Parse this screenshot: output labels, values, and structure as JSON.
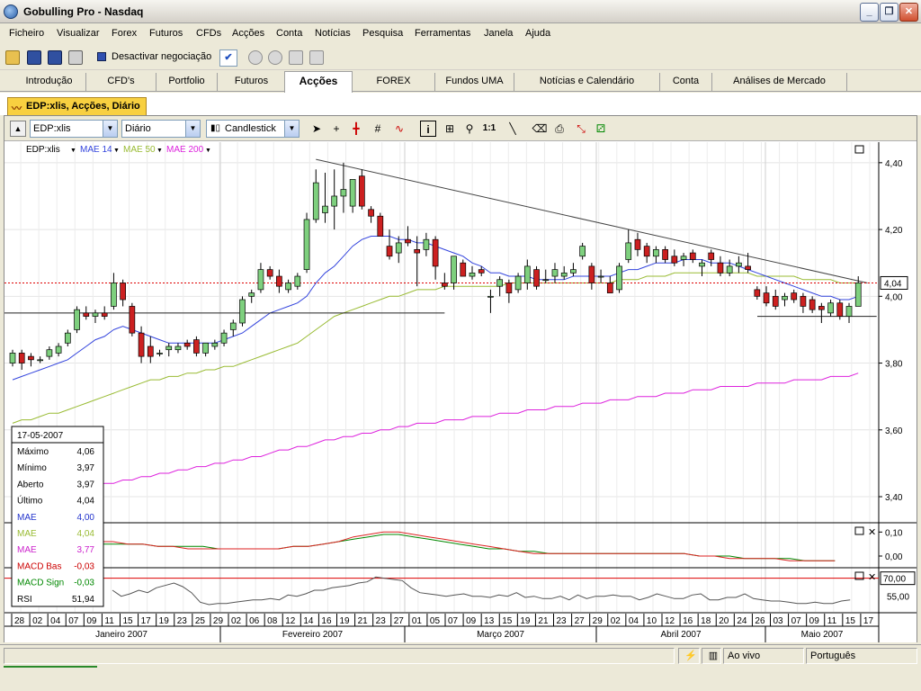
{
  "window": {
    "title": "Gobulling Pro - Nasdaq"
  },
  "menu": [
    "Ficheiro",
    "Visualizar",
    "Forex",
    "Futuros",
    "CFDs",
    "Acções",
    "Conta",
    "Notícias",
    "Pesquisa",
    "Ferramentas",
    "Janela",
    "Ajuda"
  ],
  "toolbar": {
    "deactivate_label": "Desactivar negociação"
  },
  "tabs": [
    {
      "label": "Introdução"
    },
    {
      "label": "CFD's"
    },
    {
      "label": "Portfolio"
    },
    {
      "label": "Futuros"
    },
    {
      "label": "Acções",
      "active": true
    },
    {
      "label": "FOREX"
    },
    {
      "label": "Fundos UMA"
    },
    {
      "label": "Notícias e Calendário"
    },
    {
      "label": "Conta"
    },
    {
      "label": "Análises de Mercado"
    }
  ],
  "document_tab": "EDP:xlis, Acções, Diário",
  "chart_toolbar": {
    "symbol": "EDP:xlis",
    "period": "Diário",
    "style": "Candlestick"
  },
  "legend": [
    {
      "label": "EDP:xlis",
      "color": "#000000"
    },
    {
      "label": "MAE 14",
      "color": "#3344dd"
    },
    {
      "label": "MAE 50",
      "color": "#99bb33"
    },
    {
      "label": "MAE 200",
      "color": "#dd22dd"
    }
  ],
  "info_box": {
    "date": "17-05-2007",
    "rows": [
      {
        "label": "Máximo",
        "value": "4,06",
        "color": "#000000"
      },
      {
        "label": "Mínimo",
        "value": "3,97",
        "color": "#000000"
      },
      {
        "label": "Aberto",
        "value": "3,97",
        "color": "#000000"
      },
      {
        "label": "Último",
        "value": "4,04",
        "color": "#000000"
      },
      {
        "label": "MAE",
        "value": "4,00",
        "color": "#2233cc"
      },
      {
        "label": "MAE",
        "value": "4,04",
        "color": "#99bb33"
      },
      {
        "label": "MAE",
        "value": "3,77",
        "color": "#cc22cc"
      },
      {
        "label": "MACD Bas",
        "value": "-0,03",
        "color": "#cc0000"
      },
      {
        "label": "MACD Sign",
        "value": "-0,03",
        "color": "#008800"
      },
      {
        "label": "RSI",
        "value": "51,94",
        "color": "#000000"
      }
    ]
  },
  "price_axis_labels": [
    "4,40",
    "4,20",
    "4,00",
    "3,80",
    "3,60",
    "3,40"
  ],
  "macd_axis_labels": [
    "0,10",
    "0,00"
  ],
  "rsi_axis_labels": [
    "70,00",
    "55,00"
  ],
  "last_price_label": "4,04",
  "date_labels": [
    "28",
    "02",
    "04",
    "07",
    "09",
    "11",
    "15",
    "17",
    "19",
    "23",
    "25",
    "29",
    "02",
    "06",
    "08",
    "12",
    "14",
    "16",
    "19",
    "21",
    "23",
    "27",
    "01",
    "05",
    "07",
    "09",
    "13",
    "15",
    "19",
    "21",
    "23",
    "27",
    "29",
    "02",
    "04",
    "10",
    "12",
    "16",
    "18",
    "20",
    "24",
    "26",
    "03",
    "07",
    "09",
    "11",
    "15",
    "17"
  ],
  "month_labels": [
    "Janeiro 2007",
    "Fevereiro 2007",
    "Março 2007",
    "Abril 2007",
    "Maio 2007"
  ],
  "statusbar": {
    "mode": "Ao vivo",
    "language": "Português"
  },
  "colors": {
    "up": "#7ed07e",
    "down": "#cc2020",
    "accent": "#f8d040",
    "last_line": "#dd0000"
  },
  "chart_data": {
    "type": "candlestick",
    "ylim": [
      3.33,
      4.44
    ],
    "candles": [
      {
        "o": 3.8,
        "h": 3.84,
        "l": 3.79,
        "c": 3.83
      },
      {
        "o": 3.83,
        "h": 3.84,
        "l": 3.78,
        "c": 3.8
      },
      {
        "o": 3.82,
        "h": 3.83,
        "l": 3.79,
        "c": 3.81
      },
      {
        "o": 3.81,
        "h": 3.82,
        "l": 3.8,
        "c": 3.81
      },
      {
        "o": 3.82,
        "h": 3.85,
        "l": 3.81,
        "c": 3.84
      },
      {
        "o": 3.83,
        "h": 3.86,
        "l": 3.82,
        "c": 3.85
      },
      {
        "o": 3.86,
        "h": 3.9,
        "l": 3.85,
        "c": 3.89
      },
      {
        "o": 3.9,
        "h": 3.97,
        "l": 3.89,
        "c": 3.96
      },
      {
        "o": 3.95,
        "h": 3.97,
        "l": 3.93,
        "c": 3.94
      },
      {
        "o": 3.94,
        "h": 3.96,
        "l": 3.92,
        "c": 3.95
      },
      {
        "o": 3.95,
        "h": 3.97,
        "l": 3.93,
        "c": 3.94
      },
      {
        "o": 3.97,
        "h": 4.07,
        "l": 3.96,
        "c": 4.04
      },
      {
        "o": 4.04,
        "h": 4.05,
        "l": 3.97,
        "c": 3.99
      },
      {
        "o": 3.97,
        "h": 3.98,
        "l": 3.88,
        "c": 3.89
      },
      {
        "o": 3.89,
        "h": 3.91,
        "l": 3.8,
        "c": 3.82
      },
      {
        "o": 3.85,
        "h": 3.88,
        "l": 3.8,
        "c": 3.82
      },
      {
        "o": 3.83,
        "h": 3.84,
        "l": 3.82,
        "c": 3.83
      },
      {
        "o": 3.84,
        "h": 3.86,
        "l": 3.82,
        "c": 3.85
      },
      {
        "o": 3.84,
        "h": 3.86,
        "l": 3.83,
        "c": 3.85
      },
      {
        "o": 3.86,
        "h": 3.87,
        "l": 3.84,
        "c": 3.85
      },
      {
        "o": 3.87,
        "h": 3.88,
        "l": 3.82,
        "c": 3.83
      },
      {
        "o": 3.83,
        "h": 3.86,
        "l": 3.82,
        "c": 3.86
      },
      {
        "o": 3.85,
        "h": 3.87,
        "l": 3.84,
        "c": 3.86
      },
      {
        "o": 3.86,
        "h": 3.9,
        "l": 3.85,
        "c": 3.89
      },
      {
        "o": 3.9,
        "h": 3.93,
        "l": 3.88,
        "c": 3.92
      },
      {
        "o": 3.92,
        "h": 4.0,
        "l": 3.91,
        "c": 3.99
      },
      {
        "o": 4.0,
        "h": 4.02,
        "l": 3.98,
        "c": 4.01
      },
      {
        "o": 4.02,
        "h": 4.1,
        "l": 4.01,
        "c": 4.08
      },
      {
        "o": 4.08,
        "h": 4.09,
        "l": 4.05,
        "c": 4.06
      },
      {
        "o": 4.06,
        "h": 4.08,
        "l": 4.01,
        "c": 4.03
      },
      {
        "o": 4.02,
        "h": 4.05,
        "l": 4.01,
        "c": 4.04
      },
      {
        "o": 4.03,
        "h": 4.07,
        "l": 4.02,
        "c": 4.06
      },
      {
        "o": 4.08,
        "h": 4.25,
        "l": 4.07,
        "c": 4.23
      },
      {
        "o": 4.23,
        "h": 4.38,
        "l": 4.22,
        "c": 4.34
      },
      {
        "o": 4.25,
        "h": 4.37,
        "l": 4.22,
        "c": 4.27
      },
      {
        "o": 4.27,
        "h": 4.38,
        "l": 4.2,
        "c": 4.3
      },
      {
        "o": 4.3,
        "h": 4.4,
        "l": 4.25,
        "c": 4.32
      },
      {
        "o": 4.27,
        "h": 4.34,
        "l": 4.25,
        "c": 4.35
      },
      {
        "o": 4.36,
        "h": 4.38,
        "l": 4.26,
        "c": 4.27
      },
      {
        "o": 4.26,
        "h": 4.27,
        "l": 4.22,
        "c": 4.24
      },
      {
        "o": 4.24,
        "h": 4.25,
        "l": 4.18,
        "c": 4.18
      },
      {
        "o": 4.15,
        "h": 4.2,
        "l": 4.11,
        "c": 4.12
      },
      {
        "o": 4.13,
        "h": 4.18,
        "l": 4.1,
        "c": 4.16
      },
      {
        "o": 4.17,
        "h": 4.21,
        "l": 4.15,
        "c": 4.16
      },
      {
        "o": 4.14,
        "h": 4.18,
        "l": 4.03,
        "c": 4.13
      },
      {
        "o": 4.14,
        "h": 4.19,
        "l": 4.12,
        "c": 4.17
      },
      {
        "o": 4.17,
        "h": 4.18,
        "l": 4.05,
        "c": 4.09
      },
      {
        "o": 4.04,
        "h": 4.07,
        "l": 4.02,
        "c": 4.03
      },
      {
        "o": 4.04,
        "h": 4.12,
        "l": 4.02,
        "c": 4.12
      },
      {
        "o": 4.1,
        "h": 4.11,
        "l": 4.06,
        "c": 4.06
      },
      {
        "o": 4.06,
        "h": 4.09,
        "l": 4.05,
        "c": 4.07
      },
      {
        "o": 4.08,
        "h": 4.09,
        "l": 4.06,
        "c": 4.07
      },
      {
        "o": 4.0,
        "h": 4.02,
        "l": 3.95,
        "c": 4.0
      },
      {
        "o": 4.03,
        "h": 4.06,
        "l": 4.0,
        "c": 4.05
      },
      {
        "o": 4.04,
        "h": 4.05,
        "l": 3.98,
        "c": 4.01
      },
      {
        "o": 4.02,
        "h": 4.07,
        "l": 4.01,
        "c": 4.06
      },
      {
        "o": 4.04,
        "h": 4.11,
        "l": 4.02,
        "c": 4.09
      },
      {
        "o": 4.08,
        "h": 4.09,
        "l": 4.02,
        "c": 4.03
      },
      {
        "o": 4.05,
        "h": 4.08,
        "l": 4.04,
        "c": 4.05
      },
      {
        "o": 4.06,
        "h": 4.1,
        "l": 4.04,
        "c": 4.08
      },
      {
        "o": 4.06,
        "h": 4.09,
        "l": 4.05,
        "c": 4.07
      },
      {
        "o": 4.07,
        "h": 4.1,
        "l": 4.06,
        "c": 4.08
      },
      {
        "o": 4.12,
        "h": 4.16,
        "l": 4.11,
        "c": 4.15
      },
      {
        "o": 4.09,
        "h": 4.1,
        "l": 4.02,
        "c": 4.04
      },
      {
        "o": 4.06,
        "h": 4.08,
        "l": 4.04,
        "c": 4.06
      },
      {
        "o": 4.04,
        "h": 4.06,
        "l": 4.01,
        "c": 4.01
      },
      {
        "o": 4.02,
        "h": 4.1,
        "l": 4.01,
        "c": 4.09
      },
      {
        "o": 4.11,
        "h": 4.2,
        "l": 4.1,
        "c": 4.16
      },
      {
        "o": 4.17,
        "h": 4.19,
        "l": 4.12,
        "c": 4.14
      },
      {
        "o": 4.15,
        "h": 4.16,
        "l": 4.1,
        "c": 4.12
      },
      {
        "o": 4.12,
        "h": 4.15,
        "l": 4.1,
        "c": 4.14
      },
      {
        "o": 4.14,
        "h": 4.15,
        "l": 4.1,
        "c": 4.11
      },
      {
        "o": 4.12,
        "h": 4.14,
        "l": 4.09,
        "c": 4.1
      },
      {
        "o": 4.11,
        "h": 4.13,
        "l": 4.09,
        "c": 4.12
      },
      {
        "o": 4.13,
        "h": 4.14,
        "l": 4.1,
        "c": 4.11
      },
      {
        "o": 4.09,
        "h": 4.11,
        "l": 4.06,
        "c": 4.1
      },
      {
        "o": 4.13,
        "h": 4.14,
        "l": 4.09,
        "c": 4.11
      },
      {
        "o": 4.1,
        "h": 4.12,
        "l": 4.06,
        "c": 4.07
      },
      {
        "o": 4.07,
        "h": 4.11,
        "l": 4.06,
        "c": 4.09
      },
      {
        "o": 4.09,
        "h": 4.12,
        "l": 4.07,
        "c": 4.1
      },
      {
        "o": 4.09,
        "h": 4.13,
        "l": 4.07,
        "c": 4.08
      },
      {
        "o": 4.02,
        "h": 4.03,
        "l": 3.99,
        "c": 4.0
      },
      {
        "o": 4.01,
        "h": 4.03,
        "l": 3.97,
        "c": 3.98
      },
      {
        "o": 4.0,
        "h": 4.02,
        "l": 3.96,
        "c": 3.97
      },
      {
        "o": 3.99,
        "h": 4.01,
        "l": 3.97,
        "c": 4.0
      },
      {
        "o": 4.01,
        "h": 4.02,
        "l": 3.98,
        "c": 3.99
      },
      {
        "o": 4.0,
        "h": 4.01,
        "l": 3.95,
        "c": 3.97
      },
      {
        "o": 3.99,
        "h": 4.0,
        "l": 3.95,
        "c": 3.96
      },
      {
        "o": 3.97,
        "h": 3.98,
        "l": 3.92,
        "c": 3.96
      },
      {
        "o": 3.95,
        "h": 3.99,
        "l": 3.94,
        "c": 3.98
      },
      {
        "o": 3.98,
        "h": 3.99,
        "l": 3.93,
        "c": 3.94
      },
      {
        "o": 3.94,
        "h": 3.98,
        "l": 3.92,
        "c": 3.97
      },
      {
        "o": 3.97,
        "h": 4.06,
        "l": 3.97,
        "c": 4.04
      }
    ],
    "mae14": [
      3.75,
      3.76,
      3.77,
      3.78,
      3.79,
      3.8,
      3.81,
      3.83,
      3.85,
      3.87,
      3.88,
      3.9,
      3.91,
      3.9,
      3.89,
      3.88,
      3.87,
      3.86,
      3.86,
      3.86,
      3.86,
      3.86,
      3.86,
      3.87,
      3.88,
      3.89,
      3.91,
      3.93,
      3.95,
      3.96,
      3.97,
      3.98,
      4.0,
      4.04,
      4.07,
      4.09,
      4.12,
      4.15,
      4.17,
      4.18,
      4.18,
      4.18,
      4.17,
      4.17,
      4.16,
      4.16,
      4.15,
      4.14,
      4.13,
      4.12,
      4.1,
      4.09,
      4.07,
      4.07,
      4.06,
      4.06,
      4.06,
      4.05,
      4.05,
      4.05,
      4.05,
      4.06,
      4.06,
      4.06,
      4.06,
      4.06,
      4.07,
      4.08,
      4.08,
      4.09,
      4.1,
      4.1,
      4.1,
      4.11,
      4.11,
      4.11,
      4.1,
      4.1,
      4.1,
      4.09,
      4.08,
      4.07,
      4.06,
      4.05,
      4.04,
      4.03,
      4.02,
      4.01,
      4.0,
      4.0,
      3.99,
      3.99,
      4.0
    ],
    "mae50": [
      3.62,
      3.63,
      3.63,
      3.64,
      3.65,
      3.65,
      3.66,
      3.67,
      3.68,
      3.69,
      3.7,
      3.71,
      3.72,
      3.73,
      3.74,
      3.75,
      3.75,
      3.76,
      3.76,
      3.77,
      3.77,
      3.78,
      3.78,
      3.79,
      3.79,
      3.8,
      3.81,
      3.82,
      3.83,
      3.84,
      3.85,
      3.86,
      3.88,
      3.9,
      3.92,
      3.94,
      3.95,
      3.96,
      3.97,
      3.98,
      3.99,
      4.0,
      4.0,
      4.01,
      4.02,
      4.02,
      4.02,
      4.03,
      4.03,
      4.03,
      4.03,
      4.03,
      4.03,
      4.03,
      4.04,
      4.04,
      4.04,
      4.04,
      4.04,
      4.04,
      4.04,
      4.04,
      4.04,
      4.04,
      4.04,
      4.04,
      4.05,
      4.05,
      4.05,
      4.06,
      4.06,
      4.06,
      4.07,
      4.07,
      4.07,
      4.07,
      4.07,
      4.07,
      4.07,
      4.07,
      4.07,
      4.06,
      4.06,
      4.06,
      4.06,
      4.06,
      4.05,
      4.05,
      4.05,
      4.05,
      4.04,
      4.04,
      4.04
    ],
    "mae200": [
      3.39,
      3.39,
      3.4,
      3.4,
      3.41,
      3.41,
      3.42,
      3.42,
      3.43,
      3.43,
      3.44,
      3.44,
      3.45,
      3.45,
      3.46,
      3.46,
      3.47,
      3.47,
      3.48,
      3.48,
      3.49,
      3.49,
      3.5,
      3.5,
      3.51,
      3.51,
      3.52,
      3.52,
      3.53,
      3.54,
      3.54,
      3.55,
      3.55,
      3.56,
      3.57,
      3.57,
      3.58,
      3.58,
      3.59,
      3.59,
      3.6,
      3.6,
      3.61,
      3.61,
      3.62,
      3.62,
      3.62,
      3.63,
      3.63,
      3.63,
      3.64,
      3.64,
      3.64,
      3.65,
      3.65,
      3.65,
      3.66,
      3.66,
      3.66,
      3.67,
      3.67,
      3.67,
      3.68,
      3.68,
      3.68,
      3.69,
      3.69,
      3.69,
      3.7,
      3.7,
      3.7,
      3.71,
      3.71,
      3.71,
      3.72,
      3.72,
      3.72,
      3.73,
      3.73,
      3.73,
      3.73,
      3.74,
      3.74,
      3.74,
      3.74,
      3.75,
      3.75,
      3.75,
      3.75,
      3.76,
      3.76,
      3.76,
      3.77
    ],
    "trendline": {
      "from": {
        "i": 33,
        "v": 4.41
      },
      "to": {
        "i": 93,
        "v": 4.04
      }
    },
    "support_lines": [
      {
        "from": 0,
        "to": 47,
        "v": 3.95
      },
      {
        "from": 82,
        "to": 94,
        "v": 3.94
      }
    ],
    "last_price": 4.04,
    "macd": {
      "ylim": [
        -0.03,
        0.12
      ],
      "base": [
        0.05,
        0.05,
        0.05,
        0.06,
        0.06,
        0.06,
        0.06,
        0.05,
        0.05,
        0.04,
        0.04,
        0.03,
        0.03,
        0.03,
        0.03,
        0.03,
        0.03,
        0.03,
        0.04,
        0.04,
        0.05,
        0.06,
        0.08,
        0.09,
        0.1,
        0.1,
        0.09,
        0.08,
        0.07,
        0.06,
        0.05,
        0.04,
        0.03,
        0.02,
        0.01,
        0.01,
        0.01,
        0.01,
        0.01,
        0.01,
        0.01,
        0.01,
        0.01,
        0.01,
        0.01,
        0,
        0,
        -0.01,
        -0.01,
        -0.01,
        -0.01,
        -0.02,
        -0.02,
        -0.02,
        -0.02
      ],
      "signal": [
        0.04,
        0.04,
        0.05,
        0.05,
        0.05,
        0.05,
        0.05,
        0.05,
        0.05,
        0.04,
        0.04,
        0.04,
        0.04,
        0.03,
        0.03,
        0.03,
        0.03,
        0.03,
        0.04,
        0.04,
        0.05,
        0.06,
        0.07,
        0.08,
        0.09,
        0.09,
        0.08,
        0.07,
        0.06,
        0.05,
        0.04,
        0.03,
        0.03,
        0.02,
        0.02,
        0.01,
        0.01,
        0.01,
        0.01,
        0.01,
        0.01,
        0.01,
        0.01,
        0.01,
        0.01,
        0,
        0,
        0,
        -0.01,
        -0.01,
        -0.01,
        -0.01,
        -0.02,
        -0.02,
        -0.02
      ]
    },
    "rsi": {
      "ylim": [
        45,
        75
      ],
      "values": [
        60,
        55,
        57,
        60,
        58,
        62,
        64,
        66,
        63,
        58,
        50,
        48,
        49,
        49,
        50,
        51,
        52,
        52,
        53,
        52,
        56,
        55,
        57,
        60,
        60,
        62,
        63,
        64,
        66,
        67,
        71,
        70,
        69,
        68,
        62,
        58,
        57,
        56,
        55,
        56,
        57,
        55,
        55,
        54,
        56,
        55,
        58,
        54,
        55,
        53,
        53,
        55,
        52,
        56,
        53,
        55,
        55,
        56,
        55,
        55,
        52,
        54,
        57,
        55,
        53,
        53,
        56,
        57,
        52,
        52,
        54,
        54,
        57,
        53,
        52,
        51,
        51,
        50,
        49,
        49,
        50,
        49,
        49,
        51,
        52
      ]
    }
  }
}
